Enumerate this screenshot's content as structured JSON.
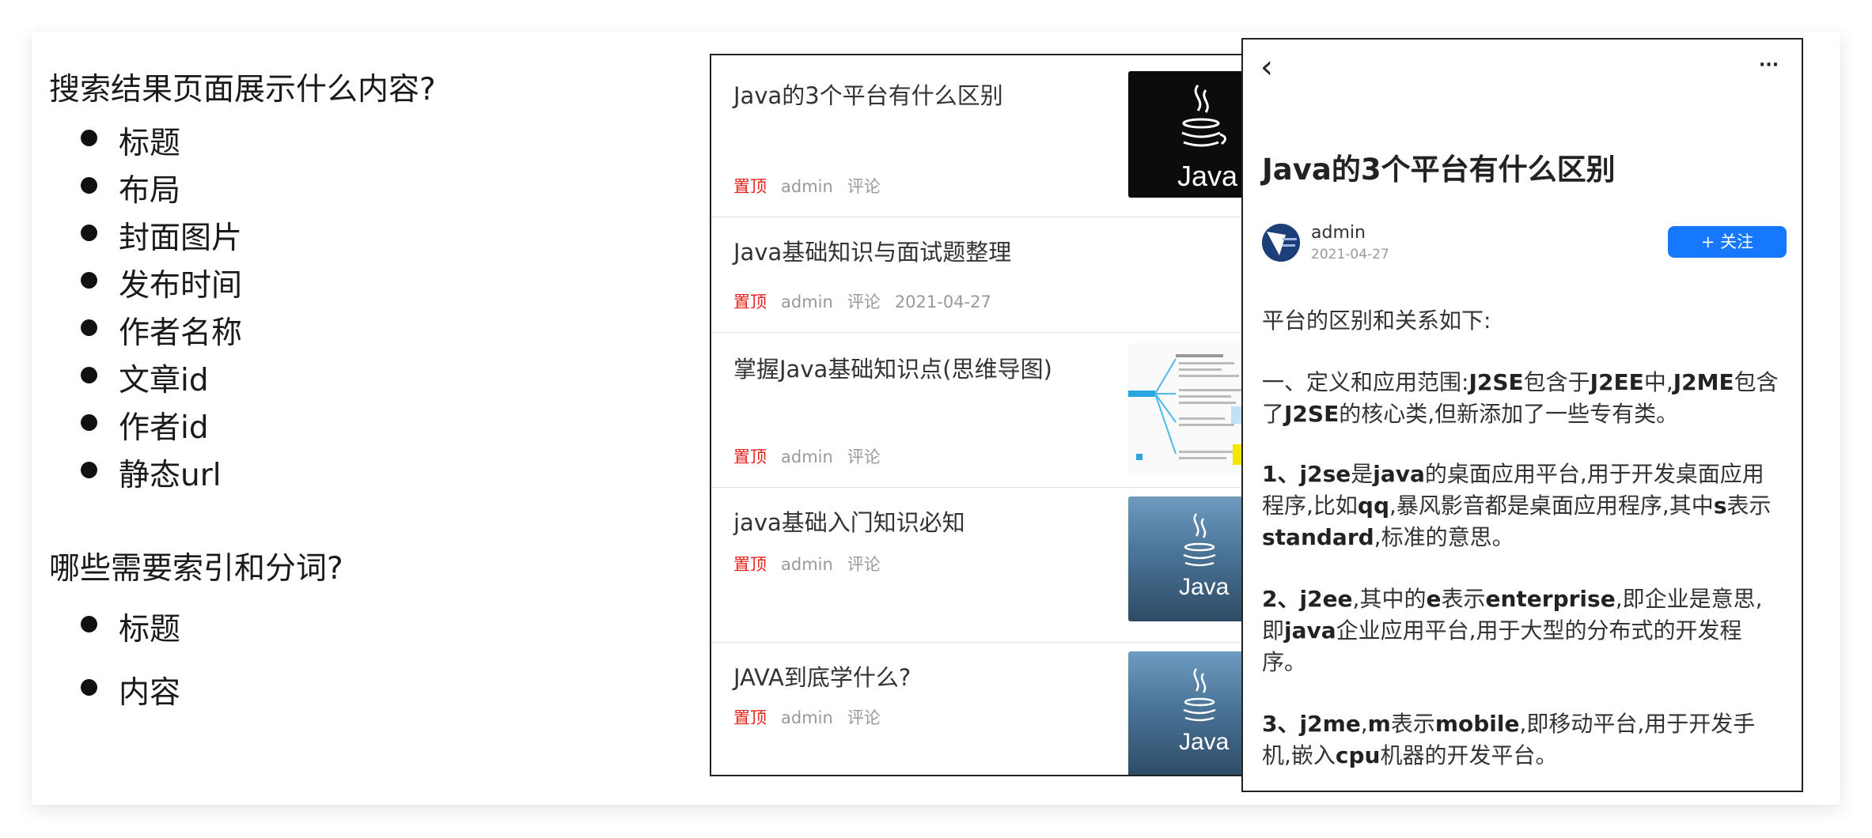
{
  "left": {
    "question1": "搜索结果页面展示什么内容?",
    "display_items": [
      "标题",
      "布局",
      "封面图片",
      "发布时间",
      "作者名称",
      "文章id",
      "作者id",
      "静态url"
    ],
    "question2": "哪些需要索引和分词?",
    "index_items": [
      "标题",
      "内容"
    ]
  },
  "list": {
    "articles": [
      {
        "title": "Java的3个平台有什么区别",
        "pin": "置顶",
        "author": "admin",
        "comment": "评论",
        "date": "",
        "thumb": "java-black-logo"
      },
      {
        "title": "Java基础知识与面试题整理",
        "pin": "置顶",
        "author": "admin",
        "comment": "评论",
        "date": "2021-04-27",
        "thumb": ""
      },
      {
        "title": "掌握Java基础知识点(思维导图)",
        "pin": "置顶",
        "author": "admin",
        "comment": "评论",
        "date": "",
        "thumb": "mindmap-image"
      },
      {
        "title": "java基础入门知识必知",
        "pin": "置顶",
        "author": "admin",
        "comment": "评论",
        "date": "",
        "thumb": "java-blue-logo"
      },
      {
        "title": "JAVA到底学什么?",
        "pin": "置顶",
        "author": "admin",
        "comment": "评论",
        "date": "",
        "thumb": "java-blue-logo"
      }
    ],
    "java_logo_text": "Java"
  },
  "detail": {
    "back_icon": "chevron-left-icon",
    "more_icon": "more-horizontal-icon",
    "back_glyph": "‹",
    "more_glyph": "···",
    "title": "Java的3个平台有什么区别",
    "author": "admin",
    "date": "2021-04-27",
    "follow_label": "+ 关注",
    "intro": "平台的区别和关系如下:",
    "p1_a": "一、定义和应用范围:",
    "p1_b": "J2SE",
    "p1_c": "包含于",
    "p1_d": "J2EE",
    "p1_e": "中,",
    "p1_f": "J2ME",
    "p1_g": "包含了",
    "p1_h": "J2SE",
    "p1_i": "的核心类,但新添加了一些专有类。",
    "p2_a": "1、",
    "p2_b": "j2se",
    "p2_c": "是",
    "p2_d": "java",
    "p2_e": "的桌面应用平台,用于开发桌面应用程序,比如",
    "p2_f": "qq",
    "p2_g": ",暴风影音都是桌面应用程序,其中",
    "p2_h": "s",
    "p2_i": "表示",
    "p2_j": "standard",
    "p2_k": ",标准的意思。",
    "p3_a": "2、",
    "p3_b": "j2ee",
    "p3_c": ",其中的",
    "p3_d": "e",
    "p3_e": "表示",
    "p3_f": "enterprise",
    "p3_g": ",即企业是意思,即",
    "p3_h": "java",
    "p3_i": "企业应用平台,用于大型的分布式的开发程序。",
    "p4_a": "3、",
    "p4_b": "j2me",
    "p4_c": ",",
    "p4_d": "m",
    "p4_e": "表示",
    "p4_f": "mobile",
    "p4_g": ",即移动平台,用于开发手机,嵌入",
    "p4_h": "cpu",
    "p4_i": "机器的开发平台。"
  },
  "colors": {
    "pin_red": "#e8231c",
    "follow_blue": "#1677ff"
  }
}
